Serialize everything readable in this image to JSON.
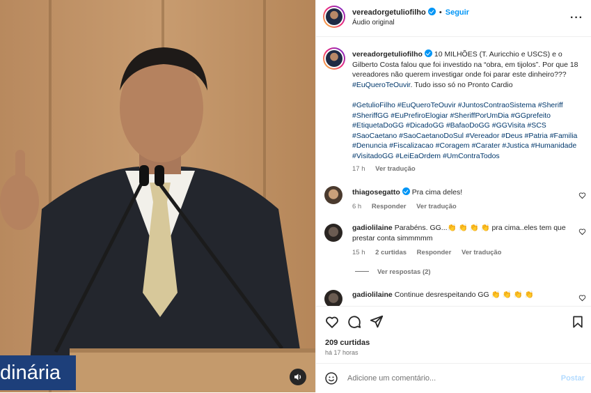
{
  "video": {
    "caption_text": "dinária",
    "sound_icon": "speaker-icon"
  },
  "header": {
    "username": "vereadorgetuliofilho",
    "follow_label": "Seguir",
    "audio_label": "Áudio original",
    "more_icon": "more-options-icon"
  },
  "post": {
    "username": "vereadorgetuliofilho",
    "text_1": "10 MILHÕES (T. Auricchio e USCS) e o Gilberto Costa falou que foi investido na “obra, em tijolos”. Por que 18 vereadores não querem investigar onde foi parar este dinheiro??? ",
    "text_tag": "#EuQueroTeOuvir",
    "text_2": ". Tudo isso só no Pronto Cardio",
    "hashtags": "#GetulioFilho #EuQueroTeOuvir #JuntosContraoSistema #Sheriff #SheriffGG #EuPrefiroElogiar #SheriffPorUmDia #GGprefeito #EtiquetaDoGG #DicadoGG #BafaoDoGG #GGVisita #SCS #SaoCaetano #SaoCaetanoDoSul #Vereador #Deus #Patria #Familia #Denuncia #Fiscalizacao #Coragem #Carater #Justica #Humanidade #VisitadoGG #LeiEaOrdem #UmContraTodos",
    "time": "17 h",
    "translate": "Ver tradução"
  },
  "comments": [
    {
      "username": "thiagosegatto",
      "verified": true,
      "text": "Pra cima deles!",
      "time": "6 h",
      "reply": "Responder",
      "translate": "Ver tradução"
    },
    {
      "username": "gadiolilaine",
      "text": "Parabéns. GG...👏 👏 👏 👏 pra cima..eles tem que prestar conta simmmmm",
      "time": "15 h",
      "likes": "2 curtidas",
      "reply": "Responder",
      "translate": "Ver tradução",
      "view_replies": "Ver respostas (2)"
    },
    {
      "username": "gadiolilaine",
      "text": "Continue desrespeitando GG 👏 👏 👏 👏"
    }
  ],
  "actions": {
    "like_icon": "heart-icon",
    "comment_icon": "comment-icon",
    "share_icon": "share-icon",
    "save_icon": "bookmark-icon",
    "likes_count": "209 curtidas",
    "time_ago": "há 17 horas"
  },
  "add_comment": {
    "emoji_icon": "emoji-icon",
    "placeholder": "Adicione um comentário...",
    "post_label": "Postar"
  },
  "colors": {
    "link": "#0095f6",
    "hashtag": "#00376b",
    "muted": "#737373"
  }
}
